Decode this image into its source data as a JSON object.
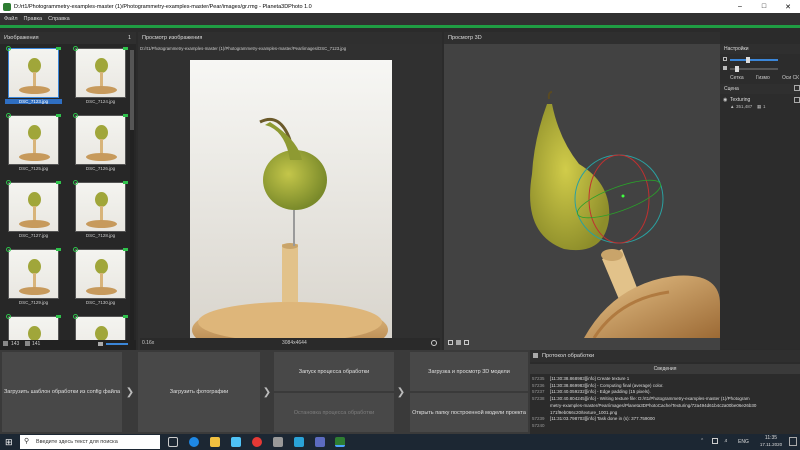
{
  "window": {
    "title": "D:/rt1/Photogrammetry-examples-master (1)/Photogrammetry-examples-master/Pear/images/gr.rmg - Planeta3DPhoto 1.0"
  },
  "menu": [
    "Файл",
    "Правка",
    "Справка"
  ],
  "images_panel": {
    "title": "Изображения",
    "count_badge": "1",
    "thumbnails": [
      {
        "label": "DSC_7123.jpg",
        "selected": true
      },
      {
        "label": "DSC_7124.jpg"
      },
      {
        "label": "DSC_7125.jpg"
      },
      {
        "label": "DSC_7126.jpg"
      },
      {
        "label": "DSC_7127.jpg"
      },
      {
        "label": "DSC_7128.jpg"
      },
      {
        "label": "DSC_7129.jpg"
      },
      {
        "label": "DSC_7130.jpg"
      },
      {
        "label": ""
      },
      {
        "label": ""
      }
    ],
    "status_total": "143",
    "status_aligned": "141"
  },
  "image_viewer": {
    "title": "Просмотр изображения",
    "path": "D:/rt1/Photogrammetry-examples-master (1)/Photogrammetry-examples-master/Pear/images/DSC_7123.jpg",
    "zoom": "0.16x",
    "resolution": "3084x4644"
  },
  "viewer3d": {
    "title": "Просмотр 3D"
  },
  "settings": {
    "title": "Настройки",
    "toggles": [
      "Сетка",
      "Гизмо",
      "Оси СК"
    ]
  },
  "scene": {
    "title": "Сцена",
    "item_name": "Texturing",
    "item_points": "351,487",
    "item_cameras": "1"
  },
  "actions": {
    "load_template": "Загрузить шаблон обработки из config файла",
    "load_photos": "Загрузить фотографии",
    "start_processing": "Запуск процесса обработки",
    "stop_processing": "Остановка процесса обработки",
    "load_view_3d": "Загрузка и просмотр 3D модели",
    "open_model_folder": "Открыть папку построенной модели проекта"
  },
  "log": {
    "title": "Протокол обработки",
    "tab": "Сведения",
    "lines": [
      {
        "no": "57235",
        "text": "[11:30:38.868983][info]  Create texture 1"
      },
      {
        "no": "57236",
        "text": "[11:30:38.869983][info]  - Computing final (average) color."
      },
      {
        "no": "57237",
        "text": "[11:30:40.059232][info]  - Edge padding (15 pixels)."
      },
      {
        "no": "57238",
        "text": "[11:30:40.804245][info]  - Writing texture file: D:/rt1/Photogrammetry-examples-master (1)/Photogram"
      },
      {
        "no": "",
        "text": "metry-examples-master/Pear/images/Planeta3DPhotoCache/Texturing/72a494d61b4c2a00be06e26b30"
      },
      {
        "no": "",
        "text": "171f9eb066c20/texture_1001.png"
      },
      {
        "no": "57239",
        "text": "[11:31:03.798703][info]  Task done in (s): 377.759000"
      },
      {
        "no": "57240",
        "text": ""
      }
    ]
  },
  "taskbar": {
    "search_placeholder": "Введите здесь текст для поиска",
    "lang": "ENG",
    "time": "11:35",
    "date": "17.11.2020"
  }
}
